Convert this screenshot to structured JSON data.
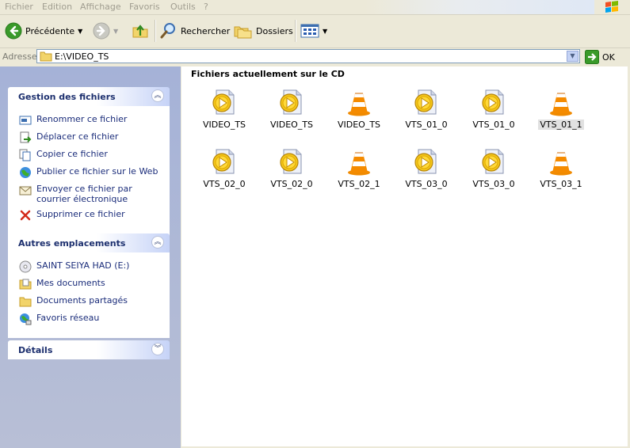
{
  "menu": [
    "Fichier",
    "Edition",
    "Affichage",
    "Favoris",
    "Outils",
    "?"
  ],
  "toolbar": {
    "back_label": "Précédente",
    "search_label": "Rechercher",
    "folders_label": "Dossiers"
  },
  "address": {
    "label": "Adresse",
    "value": "E:\\VIDEO_TS",
    "go_label": "OK"
  },
  "tasks": {
    "file_management": {
      "title": "Gestion des fichiers",
      "items": [
        "Renommer ce fichier",
        "Déplacer ce fichier",
        "Copier ce fichier",
        "Publier ce fichier sur le Web",
        "Envoyer ce fichier par courrier électronique",
        "Supprimer ce fichier"
      ]
    },
    "other_places": {
      "title": "Autres emplacements",
      "items": [
        "SAINT SEIYA HAD (E:)",
        "Mes documents",
        "Documents partagés",
        "Favoris réseau"
      ]
    },
    "details": {
      "title": "Détails"
    }
  },
  "main": {
    "title": "Fichiers actuellement sur le CD",
    "files": [
      {
        "name": "VIDEO_TS",
        "type": "media-file-icon"
      },
      {
        "name": "VIDEO_TS",
        "type": "media-file-icon"
      },
      {
        "name": "VIDEO_TS",
        "type": "vlc-cone-icon"
      },
      {
        "name": "VTS_01_0",
        "type": "media-file-icon"
      },
      {
        "name": "VTS_01_0",
        "type": "media-file-icon"
      },
      {
        "name": "VTS_01_1",
        "type": "vlc-cone-icon",
        "selected": true
      },
      {
        "name": "VTS_02_0",
        "type": "media-file-icon"
      },
      {
        "name": "VTS_02_0",
        "type": "media-file-icon"
      },
      {
        "name": "VTS_02_1",
        "type": "vlc-cone-icon"
      },
      {
        "name": "VTS_03_0",
        "type": "media-file-icon"
      },
      {
        "name": "VTS_03_0",
        "type": "media-file-icon"
      },
      {
        "name": "VTS_03_1",
        "type": "vlc-cone-icon"
      }
    ]
  },
  "colors": {
    "chrome": "#ece9d8",
    "task_pane": "#b8bfd6",
    "accent_blue": "#215dc6",
    "vlc_orange": "#f08a00"
  }
}
